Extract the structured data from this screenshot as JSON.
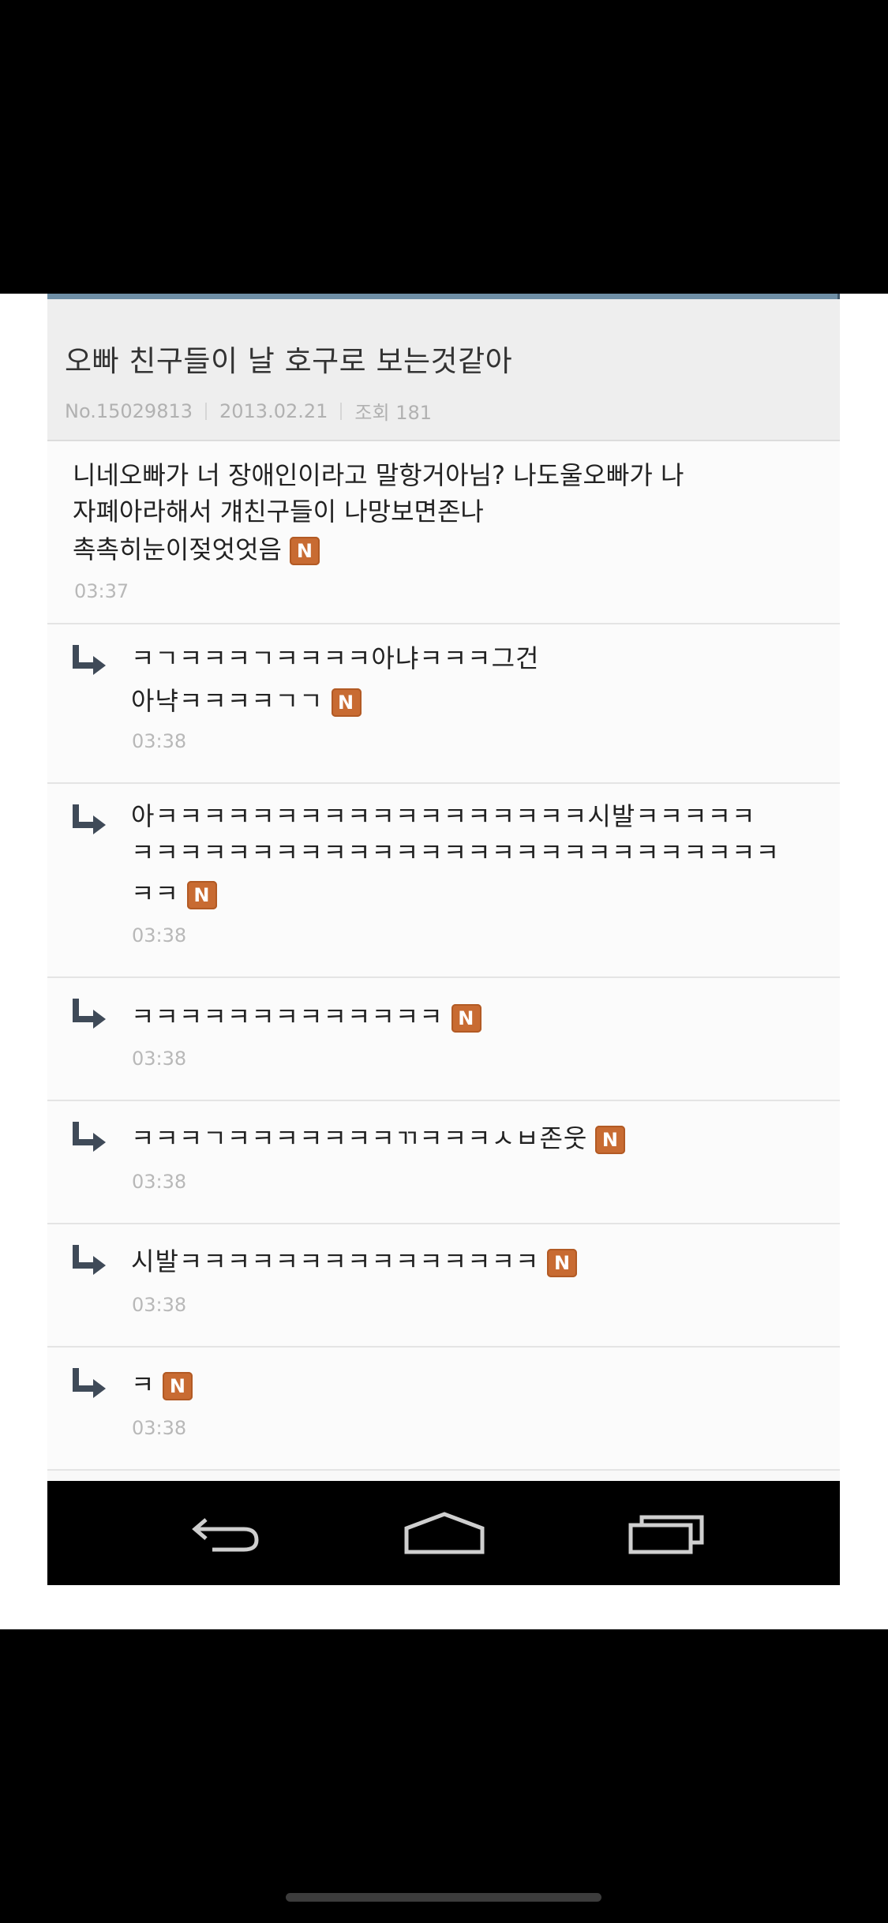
{
  "post": {
    "title": "오빠 친구들이 날 호구로 보는것같아",
    "number": "No.15029813",
    "date": "2013.02.21",
    "views": "조회 181",
    "body_lines": [
      "니네오빠가 너 장애인이라고 말항거아님? 나도울오빠가 나",
      "자폐아라해서 걔친구들이 나망보면존나",
      "촉촉히눈이젖엇엇음"
    ],
    "time": "03:37",
    "badge": "N"
  },
  "replies": [
    {
      "lines": [
        "ㅋㄱㅋㅋㅋㄱㅋㅋㅋㅋ아냐ㅋㅋㅋ그건",
        "아냑ㅋㅋㅋㅋㄱㄱ"
      ],
      "time": "03:38",
      "badge": "N"
    },
    {
      "lines": [
        "아ㅋㅋㅋㅋㅋㅋㅋㅋㅋㅋㅋㅋㅋㅋㅋㅋㅋㅋ시발ㅋㅋㅋㅋㅋ",
        "ㅋㅋㅋㅋㅋㅋㅋㅋㅋㅋㅋㅋㅋㅋㅋㅋㅋㅋㅋㅋㅋㅋㅋㅋㅋㅋㅋ",
        "ㅋㅋ"
      ],
      "time": "03:38",
      "badge": "N"
    },
    {
      "lines": [
        "ㅋㅋㅋㅋㅋㅋㅋㅋㅋㅋㅋㅋㅋ"
      ],
      "time": "03:38",
      "badge": "N"
    },
    {
      "lines": [
        "ㅋㅋㅋㄱㅋㅋㅋㅋㅋㅋㅋㄲㅋㅋㅋㅅㅂ존웃"
      ],
      "time": "03:38",
      "badge": "N"
    },
    {
      "lines": [
        "시발ㅋㅋㅋㅋㅋㅋㅋㅋㅋㅋㅋㅋㅋㅋㅋ"
      ],
      "time": "03:38",
      "badge": "N"
    },
    {
      "lines": [
        "ㅋ"
      ],
      "time": "03:38",
      "badge": "N"
    }
  ],
  "navbar": {
    "icons": [
      "back-icon",
      "home-icon",
      "recent-apps-icon"
    ]
  }
}
